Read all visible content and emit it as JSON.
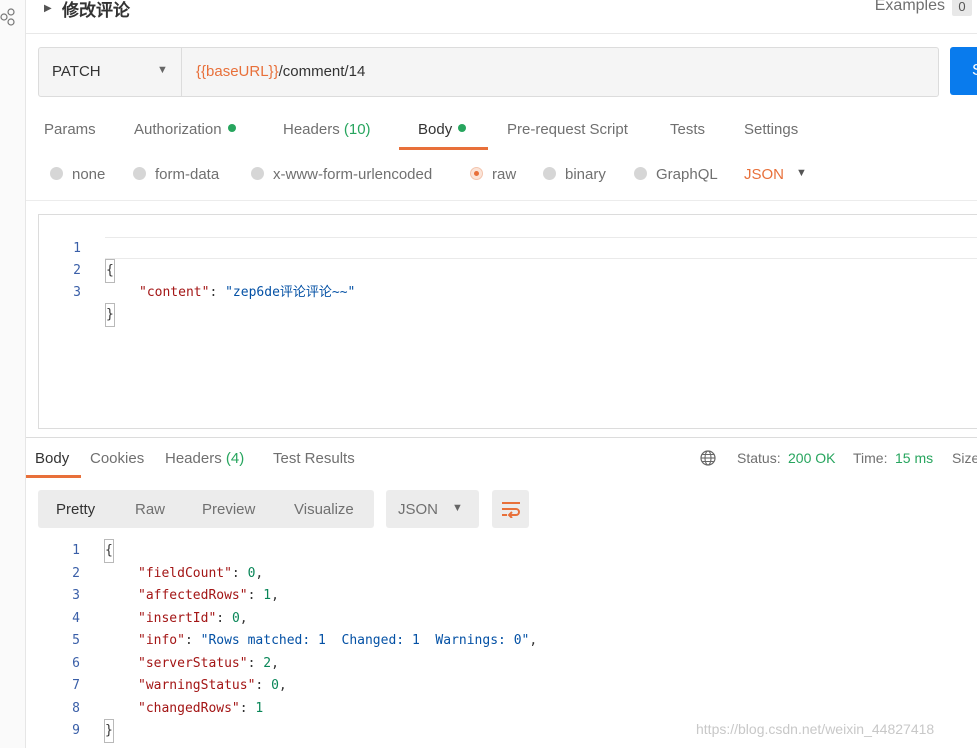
{
  "title": "修改评论",
  "examples": {
    "label": "Examples",
    "count": "0"
  },
  "request": {
    "method": "PATCH",
    "url_var": "{{baseURL}}",
    "url_path": "/comment/14",
    "send_label": "S"
  },
  "request_tabs": {
    "params": "Params",
    "authorization": "Authorization",
    "headers": "Headers",
    "headers_count": "(10)",
    "body": "Body",
    "prerequest": "Pre-request Script",
    "tests": "Tests",
    "settings": "Settings"
  },
  "body_types": {
    "none": "none",
    "form_data": "form-data",
    "urlencoded": "x-www-form-urlencoded",
    "raw": "raw",
    "binary": "binary",
    "graphql": "GraphQL",
    "selected": "raw",
    "format": "JSON"
  },
  "request_body": {
    "line_numbers": [
      "1",
      "2",
      "3"
    ],
    "open": "{",
    "key": "\"content\"",
    "colon": ": ",
    "value": "\"zep6de评论评论~~\"",
    "close": "}"
  },
  "response_tabs": {
    "body": "Body",
    "cookies": "Cookies",
    "headers": "Headers",
    "headers_count": "(4)",
    "test_results": "Test Results"
  },
  "response_status": {
    "status_label": "Status:",
    "status_value": "200 OK",
    "time_label": "Time:",
    "time_value": "15 ms",
    "size_label": "Size"
  },
  "response_view": {
    "pretty": "Pretty",
    "raw": "Raw",
    "preview": "Preview",
    "visualize": "Visualize",
    "format": "JSON"
  },
  "response_body": {
    "line_numbers": [
      "1",
      "2",
      "3",
      "4",
      "5",
      "6",
      "7",
      "8",
      "9"
    ],
    "open": "{",
    "close": "}",
    "fields": [
      {
        "key": "\"fieldCount\"",
        "value": "0",
        "type": "num",
        "comma": ","
      },
      {
        "key": "\"affectedRows\"",
        "value": "1",
        "type": "num",
        "comma": ","
      },
      {
        "key": "\"insertId\"",
        "value": "0",
        "type": "num",
        "comma": ","
      },
      {
        "key": "\"info\"",
        "value": "\"Rows matched: 1  Changed: 1  Warnings: 0\"",
        "type": "str",
        "comma": ","
      },
      {
        "key": "\"serverStatus\"",
        "value": "2",
        "type": "num",
        "comma": ","
      },
      {
        "key": "\"warningStatus\"",
        "value": "0",
        "type": "num",
        "comma": ","
      },
      {
        "key": "\"changedRows\"",
        "value": "1",
        "type": "num",
        "comma": ""
      }
    ]
  },
  "watermark": "https://blog.csdn.net/weixin_44827418",
  "colors": {
    "accent": "#e8703a",
    "success": "#27a55e",
    "send": "#097bed"
  }
}
